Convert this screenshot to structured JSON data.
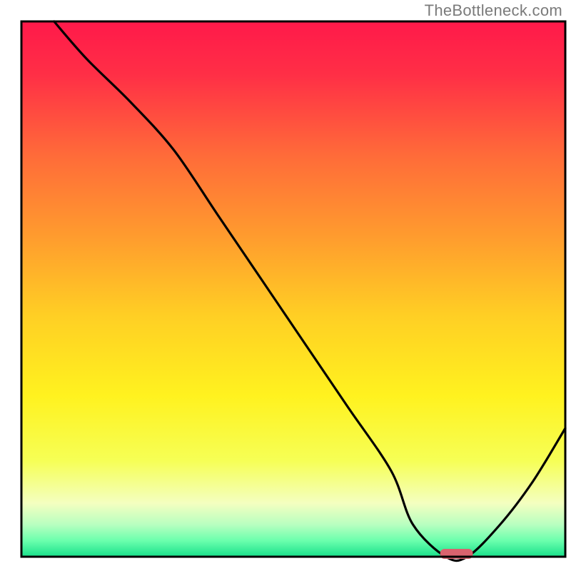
{
  "watermark": "TheBottleneck.com",
  "chart_data": {
    "type": "line",
    "title": "",
    "xlabel": "",
    "ylabel": "",
    "xlim": [
      0,
      100
    ],
    "ylim": [
      0,
      100
    ],
    "grid": false,
    "series": [
      {
        "name": "bottleneck-curve",
        "x": [
          6,
          12,
          20,
          28,
          36,
          44,
          52,
          60,
          68,
          72,
          78,
          82,
          88,
          94,
          100
        ],
        "values": [
          100,
          93,
          85,
          76,
          64,
          52,
          40,
          28,
          16,
          6,
          0,
          0,
          6,
          14,
          24
        ]
      }
    ],
    "marker": {
      "name": "optimal-range-marker",
      "x": 80,
      "width": 6,
      "color": "#d9636e"
    },
    "gradient_stops": [
      {
        "offset": 0.0,
        "color": "#ff194a"
      },
      {
        "offset": 0.1,
        "color": "#ff2f46"
      },
      {
        "offset": 0.25,
        "color": "#ff6b39"
      },
      {
        "offset": 0.4,
        "color": "#ff9b2e"
      },
      {
        "offset": 0.55,
        "color": "#ffcf24"
      },
      {
        "offset": 0.7,
        "color": "#fff21f"
      },
      {
        "offset": 0.82,
        "color": "#f6ff55"
      },
      {
        "offset": 0.9,
        "color": "#f4ffc0"
      },
      {
        "offset": 0.94,
        "color": "#b8ffc0"
      },
      {
        "offset": 0.97,
        "color": "#6bffad"
      },
      {
        "offset": 1.0,
        "color": "#18e08a"
      }
    ]
  }
}
